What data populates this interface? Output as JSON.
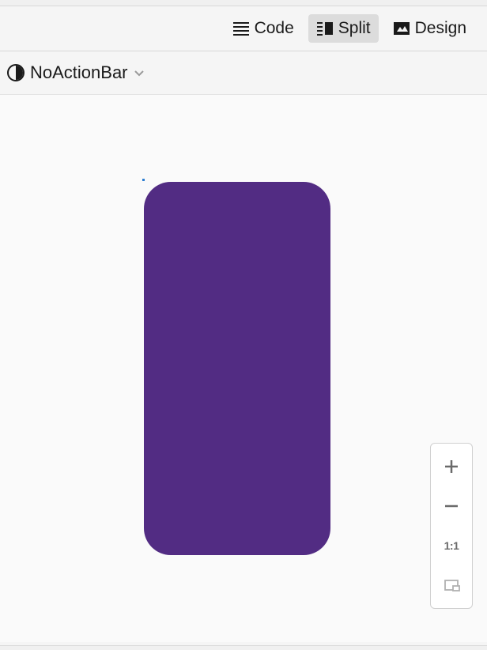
{
  "viewModes": {
    "code": "Code",
    "split": "Split",
    "design": "Design",
    "active": "split"
  },
  "config": {
    "themeLabel": "NoActionBar"
  },
  "zoom": {
    "oneToOne": "1:1"
  },
  "colors": {
    "devicePreview": "#522c83"
  }
}
